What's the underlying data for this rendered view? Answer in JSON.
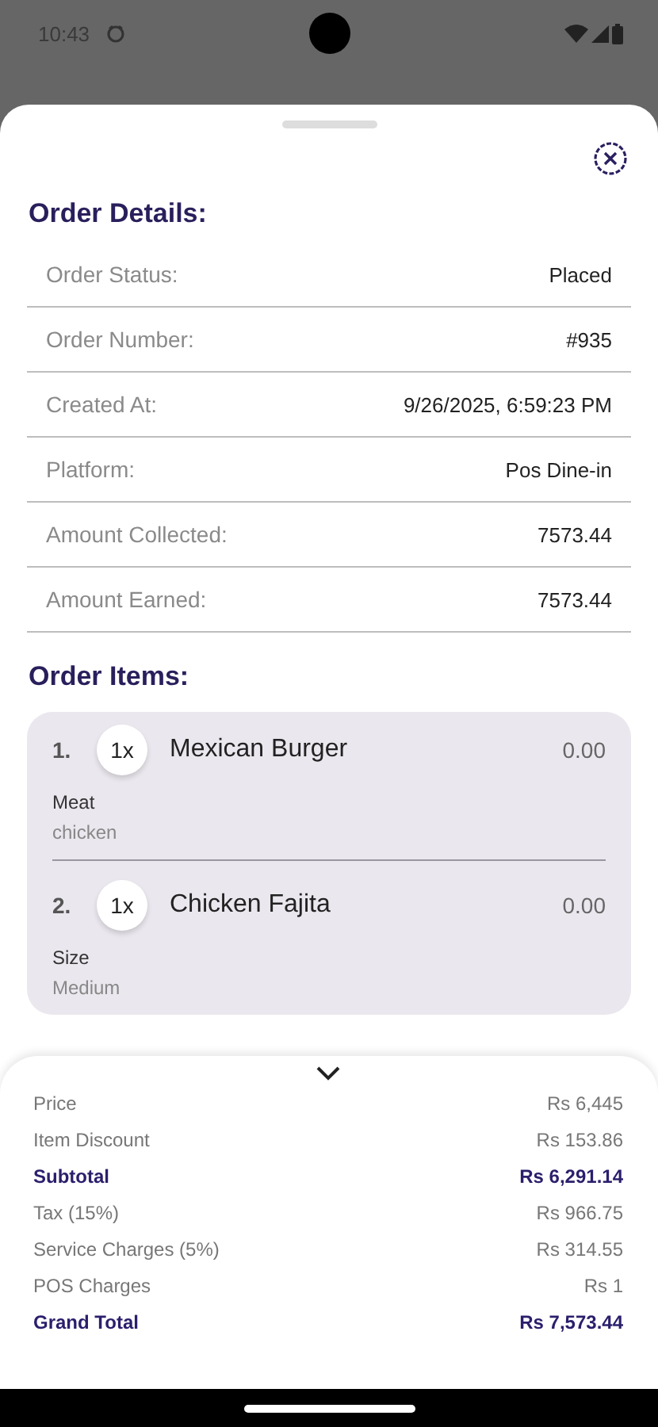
{
  "status_bar": {
    "time": "10:43"
  },
  "order_details": {
    "title": "Order Details:",
    "rows": [
      {
        "label": "Order Status:",
        "value": "Placed"
      },
      {
        "label": "Order Number:",
        "value": "#935"
      },
      {
        "label": "Created At:",
        "value": "9/26/2025, 6:59:23 PM"
      },
      {
        "label": "Platform:",
        "value": "Pos Dine-in"
      },
      {
        "label": "Amount Collected:",
        "value": "7573.44"
      },
      {
        "label": "Amount Earned:",
        "value": "7573.44"
      }
    ]
  },
  "order_items": {
    "title": "Order Items:",
    "items": [
      {
        "index": "1.",
        "quantity": "1x",
        "name": "Mexican Burger",
        "price": "0.00",
        "options": [
          {
            "name": "Meat",
            "value": "chicken"
          }
        ]
      },
      {
        "index": "2.",
        "quantity": "1x",
        "name": "Chicken Fajita",
        "price": "0.00",
        "options": [
          {
            "name": "Size",
            "value": "Medium"
          }
        ]
      }
    ]
  },
  "summary": {
    "rows": [
      {
        "kind": "regular",
        "label": "Price",
        "value": "Rs 6,445"
      },
      {
        "kind": "regular",
        "label": "Item Discount",
        "value": "Rs 153.86"
      },
      {
        "kind": "total",
        "label": "Subtotal",
        "value": "Rs 6,291.14"
      },
      {
        "kind": "regular",
        "label": "Tax (15%)",
        "value": "Rs 966.75"
      },
      {
        "kind": "regular",
        "label": "Service Charges (5%)",
        "value": "Rs 314.55"
      },
      {
        "kind": "regular",
        "label": "POS Charges",
        "value": "Rs 1"
      },
      {
        "kind": "total",
        "label": "Grand Total",
        "value": "Rs 7,573.44"
      }
    ]
  }
}
